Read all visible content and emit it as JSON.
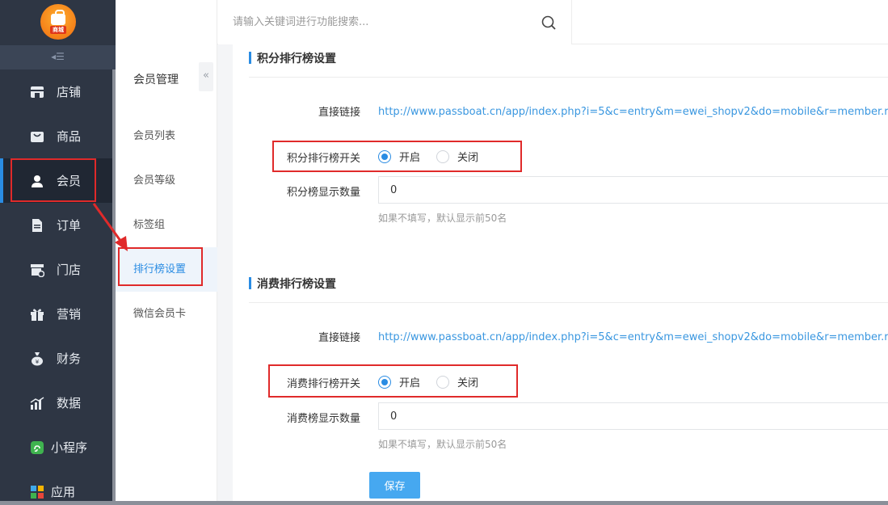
{
  "logo": {
    "text": "商城"
  },
  "sidebar": {
    "collapse_symbol": "◂☰",
    "items": [
      {
        "label": "店铺",
        "icon": "store-icon"
      },
      {
        "label": "商品",
        "icon": "shopping-bag-icon"
      },
      {
        "label": "会员",
        "icon": "user-icon"
      },
      {
        "label": "订单",
        "icon": "document-icon"
      },
      {
        "label": "门店",
        "icon": "shop-settings-icon"
      },
      {
        "label": "营销",
        "icon": "gift-icon"
      },
      {
        "label": "财务",
        "icon": "money-bag-icon"
      },
      {
        "label": "数据",
        "icon": "bar-chart-icon"
      },
      {
        "label": "小程序",
        "icon": "mini-program-icon"
      },
      {
        "label": "应用",
        "icon": "apps-icon"
      }
    ],
    "active_index": 2
  },
  "submenu": {
    "title": "会员管理",
    "toggle_symbol": "«",
    "items": [
      {
        "label": "会员列表"
      },
      {
        "label": "会员等级"
      },
      {
        "label": "标签组"
      },
      {
        "label": "排行榜设置"
      },
      {
        "label": "微信会员卡"
      }
    ],
    "active_index": 3
  },
  "topbar": {
    "search_placeholder": "请输入关键词进行功能搜索..."
  },
  "points_section": {
    "title": "积分排行榜设置",
    "link_label": "直接链接",
    "link_url": "http://www.passboat.cn/app/index.php?i=5&c=entry&m=ewei_shopv2&do=mobile&r=member.rank",
    "switch_label": "积分排行榜开关",
    "option_on": "开启",
    "option_off": "关闭",
    "selected": "on",
    "count_label": "积分榜显示数量",
    "count_value": "0",
    "hint": "如果不填写，默认显示前50名"
  },
  "consume_section": {
    "title": "消费排行榜设置",
    "link_label": "直接链接",
    "link_url": "http://www.passboat.cn/app/index.php?i=5&c=entry&m=ewei_shopv2&do=mobile&r=member.rank",
    "switch_label": "消费排行榜开关",
    "option_on": "开启",
    "option_off": "关闭",
    "selected": "on",
    "count_label": "消费榜显示数量",
    "count_value": "0",
    "hint": "如果不填写，默认显示前50名"
  },
  "save_label": "保存",
  "colors": {
    "sidebar_bg": "#2e3644",
    "accent": "#2a8ce3",
    "annotation_red": "#e02a2a",
    "save_button": "#46a8f0"
  }
}
